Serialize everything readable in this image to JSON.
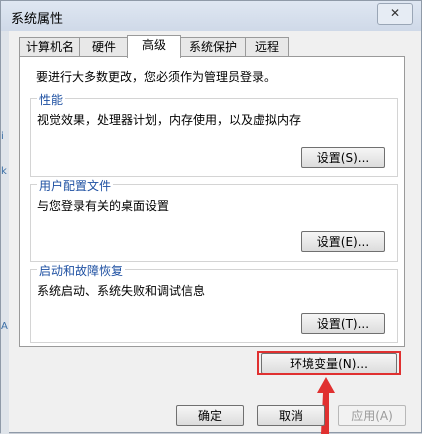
{
  "window": {
    "title": "系统属性",
    "close_label": "✕"
  },
  "tabs": [
    {
      "label": "计算机名"
    },
    {
      "label": "硬件"
    },
    {
      "label": "高级",
      "active": true
    },
    {
      "label": "系统保护"
    },
    {
      "label": "远程"
    }
  ],
  "panel": {
    "warning": "要进行大多数更改，您必须作为管理员登录。",
    "performance": {
      "title": "性能",
      "desc": "视觉效果，处理器计划，内存使用，以及虚拟内存",
      "button": "设置(S)..."
    },
    "user_profiles": {
      "title": "用户配置文件",
      "desc": "与您登录有关的桌面设置",
      "button": "设置(E)..."
    },
    "startup_recovery": {
      "title": "启动和故障恢复",
      "desc": "系统启动、系统失败和调试信息",
      "button": "设置(T)..."
    }
  },
  "env_button": "环境变量(N)...",
  "footer": {
    "ok": "确定",
    "cancel": "取消",
    "apply": "应用(A)"
  },
  "background_fragments": {
    "a": "i",
    "b": "k",
    "c": "A"
  },
  "colors": {
    "highlight": "#e03030",
    "group_title": "#1e50a2"
  }
}
